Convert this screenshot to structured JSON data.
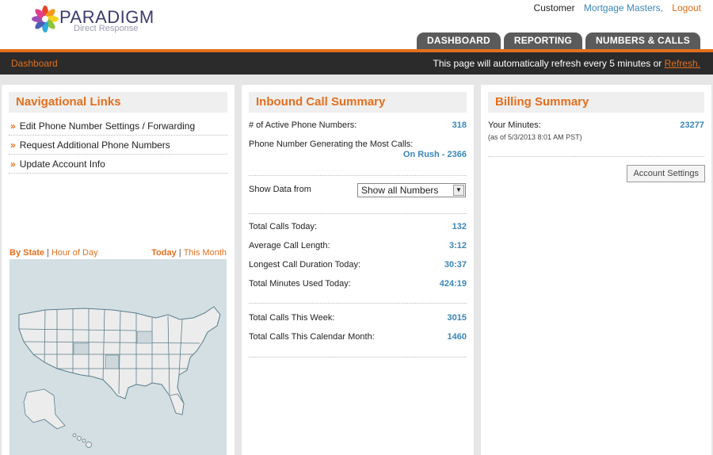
{
  "brand": {
    "name": "PARADIGM",
    "sub": "Direct Response"
  },
  "topbar": {
    "label": "Customer",
    "company": "Mortgage Masters,",
    "logout": "Logout"
  },
  "tabs": [
    {
      "label": "DASHBOARD"
    },
    {
      "label": "REPORTING"
    },
    {
      "label": "NUMBERS & CALLS"
    }
  ],
  "nav": {
    "breadcrumb": "Dashboard",
    "refresh_text": "This page will automatically refresh every 5 minutes or",
    "refresh_link": "Refresh."
  },
  "links_panel": {
    "title": "Navigational Links",
    "items": [
      {
        "label": "Edit Phone Number Settings / Forwarding"
      },
      {
        "label": "Request Additional Phone Numbers"
      },
      {
        "label": "Update Account Info"
      }
    ],
    "map_tabs": {
      "by_state": "By State",
      "hour_of_day": "Hour of Day",
      "today": "Today",
      "this_month": "This Month",
      "sep": "|"
    }
  },
  "inbound": {
    "title": "Inbound Call Summary",
    "active_label": "# of Active Phone Numbers:",
    "active_value": "318",
    "most_calls_label": "Phone Number Generating the Most Calls:",
    "most_calls_value": "On Rush - 2366",
    "show_label": "Show Data from",
    "show_value": "Show all Numbers",
    "stats": [
      {
        "label": "Total Calls Today:",
        "value": "132"
      },
      {
        "label": "Average Call Length:",
        "value": "3:12"
      },
      {
        "label": "Longest Call Duration Today:",
        "value": "30:37"
      },
      {
        "label": "Total Minutes Used Today:",
        "value": "424:19"
      }
    ],
    "totals": [
      {
        "label": "Total Calls This Week:",
        "value": "3015"
      },
      {
        "label": "Total Calls This Calendar Month:",
        "value": "1460"
      }
    ]
  },
  "billing": {
    "title": "Billing Summary",
    "minutes_label": "Your Minutes:",
    "minutes_value": "23277",
    "as_of": "(as of 5/3/2013 8:01 AM PST)",
    "account_button": "Account Settings"
  },
  "colors": {
    "accent": "#e36f1d",
    "value_blue": "#3a86b6",
    "navbar": "#2b2b2b",
    "tab": "#5b5b5b"
  }
}
